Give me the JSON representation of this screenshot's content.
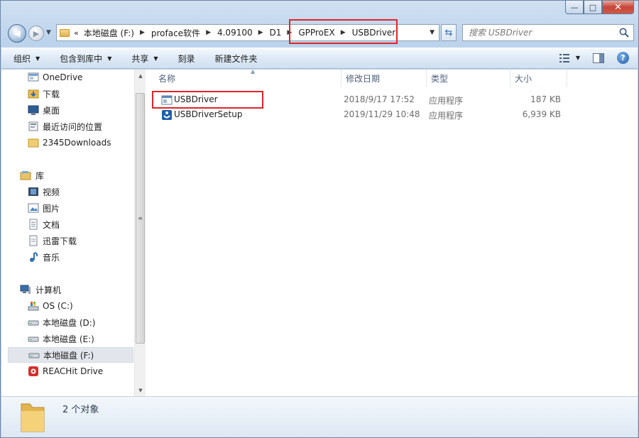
{
  "window": {
    "minimize_label": "—",
    "maximize_label": "□",
    "close_label": "✕"
  },
  "address": {
    "overflow": "«",
    "crumbs": [
      "本地磁盘 (F:)",
      "proface软件",
      "4.09100",
      "D1",
      "GPProEX",
      "USBDriver"
    ]
  },
  "search": {
    "placeholder": "搜索 USBDriver"
  },
  "toolbar": {
    "organize": "组织",
    "include_in_library": "包含到库中",
    "share": "共享",
    "burn": "刻录",
    "new_folder": "新建文件夹"
  },
  "nav": {
    "favorites": [
      {
        "label": "OneDrive",
        "icon": "onedrive-icon"
      },
      {
        "label": "下载",
        "icon": "downloads-folder-icon"
      },
      {
        "label": "桌面",
        "icon": "desktop-icon"
      },
      {
        "label": "最近访问的位置",
        "icon": "recent-places-icon"
      },
      {
        "label": "2345Downloads",
        "icon": "folder-icon"
      }
    ],
    "libraries_header": "库",
    "libraries": [
      {
        "label": "视频",
        "icon": "videos-icon"
      },
      {
        "label": "图片",
        "icon": "pictures-icon"
      },
      {
        "label": "文档",
        "icon": "documents-icon"
      },
      {
        "label": "迅雷下载",
        "icon": "thunder-downloads-icon"
      },
      {
        "label": "音乐",
        "icon": "music-icon"
      }
    ],
    "computer_header": "计算机",
    "drives": [
      {
        "label": "OS (C:)",
        "icon": "system-drive-icon"
      },
      {
        "label": "本地磁盘 (D:)",
        "icon": "drive-icon"
      },
      {
        "label": "本地磁盘 (E:)",
        "icon": "drive-icon"
      },
      {
        "label": "本地磁盘 (F:)",
        "icon": "drive-icon",
        "selected": true
      },
      {
        "label": "REACHit Drive",
        "icon": "reachit-drive-icon"
      }
    ]
  },
  "columns": {
    "name": "名称",
    "date_modified": "修改日期",
    "type": "类型",
    "size": "大小"
  },
  "files": [
    {
      "name": "USBDriver",
      "date": "2018/9/17 17:52",
      "type": "应用程序",
      "size": "187 KB",
      "icon": "application-icon"
    },
    {
      "name": "USBDriverSetup",
      "date": "2019/11/29 10:48",
      "type": "应用程序",
      "size": "6,939 KB",
      "icon": "setup-icon"
    }
  ],
  "status": {
    "item_count": "2 个对象"
  },
  "colors": {
    "highlight": "#e0252b",
    "chrome": "#bcd3ec"
  }
}
